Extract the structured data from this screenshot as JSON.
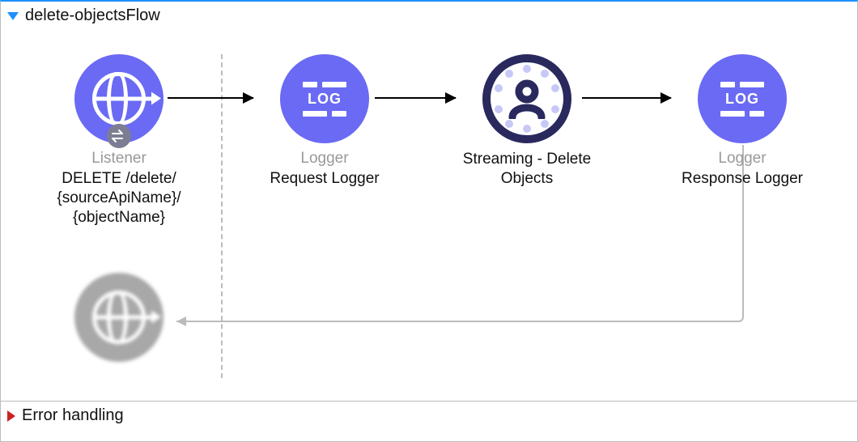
{
  "flow": {
    "title": "delete-objectsFlow",
    "nodes": [
      {
        "type": "Listener",
        "name_line1": "DELETE /delete/",
        "name_line2": "{sourceApiName}/",
        "name_line3": "{objectName}"
      },
      {
        "type": "Logger",
        "name": "Request Logger"
      },
      {
        "type": "",
        "name_line1": "Streaming - Delete",
        "name_line2": "Objects"
      },
      {
        "type": "Logger",
        "name": "Response Logger"
      }
    ],
    "log_label": "LOG"
  },
  "error_section": {
    "title": "Error handling"
  }
}
